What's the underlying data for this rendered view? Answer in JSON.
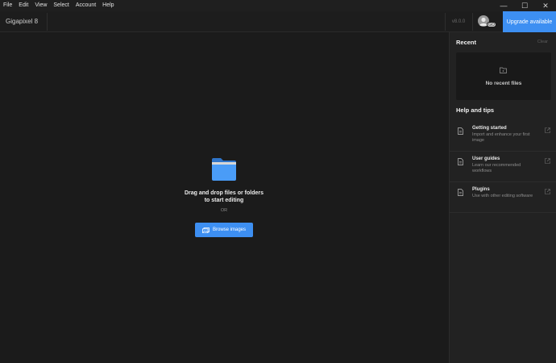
{
  "menu": {
    "items": [
      "File",
      "Edit",
      "View",
      "Select",
      "Account",
      "Help"
    ]
  },
  "window_controls": {
    "minimize": "—",
    "maximize": "☐",
    "close": "✕"
  },
  "toolbar": {
    "title": "Gigapixel 8",
    "version": "v8.0.0",
    "avatar_badge": "GO",
    "upgrade_label": "Upgrade available"
  },
  "main": {
    "drop_line1": "Drag and drop files or folders",
    "drop_line2": "to start editing",
    "or_label": "OR",
    "browse_label": "Browse images"
  },
  "recent": {
    "heading": "Recent",
    "clear_label": "Clear",
    "empty_label": "No recent files"
  },
  "help": {
    "heading": "Help and tips",
    "items": [
      {
        "title": "Getting started",
        "desc": "Import and enhance your first image"
      },
      {
        "title": "User guides",
        "desc": "Learn our recommended workflows"
      },
      {
        "title": "Plugins",
        "desc": "Use with other editing software"
      }
    ]
  },
  "colors": {
    "accent": "#3d8ff2",
    "folder": "#4a9cf7",
    "background": "#1b1b1b",
    "panel": "#222222"
  }
}
